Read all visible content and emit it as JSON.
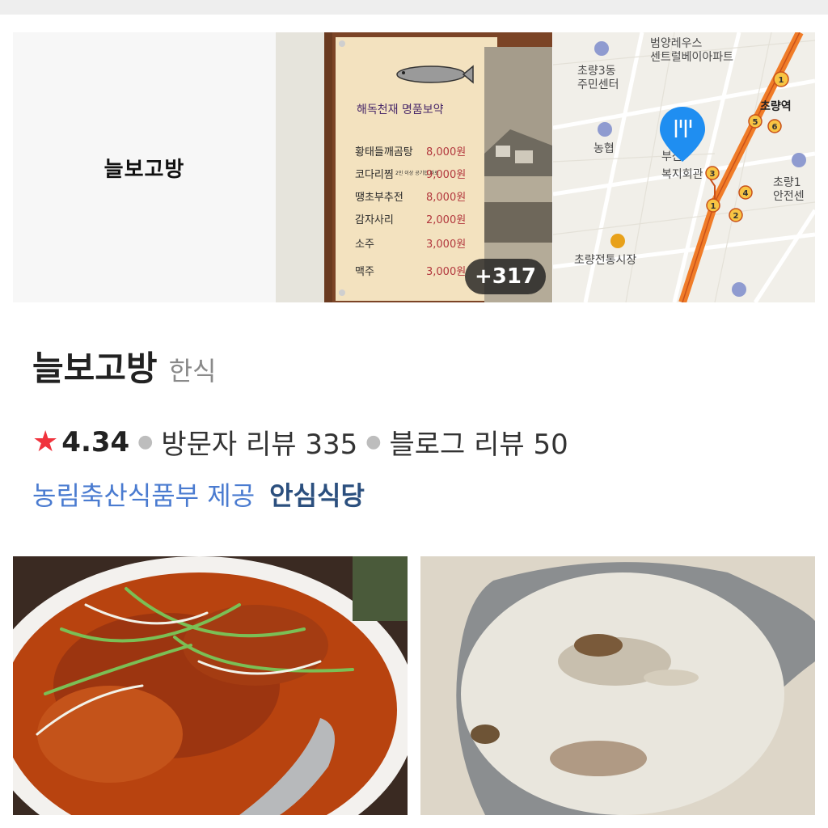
{
  "header": {
    "name_tile": "늘보고방",
    "more_photos": "+317"
  },
  "menu_board": {
    "heading": "해독천재 명품보약",
    "items": [
      {
        "name": "황태들깨곰탕",
        "price": "8,000원"
      },
      {
        "name": "코다리찜",
        "note": "2인 이상 공기밥 따로",
        "price": "9,000원"
      },
      {
        "name": "땡초부추전",
        "price": "8,000원"
      },
      {
        "name": "감자사리",
        "price": "2,000원"
      },
      {
        "name": "소주",
        "price": "3,000원"
      },
      {
        "name": "맥주",
        "price": "3,000원"
      }
    ]
  },
  "map": {
    "labels": {
      "apt": "범양레우스\n센트럴베이아파트",
      "center": "초량3동\n주민센터",
      "station": "초량역",
      "bank": "농협",
      "welfare_a": "부산",
      "welfare_b": "복지회관",
      "safety": "초량1\n안전센",
      "market": "초량전통시장"
    },
    "exits": [
      "1",
      "3",
      "4",
      "5",
      "6",
      "1",
      "2"
    ],
    "pin_color": "#1f8ef1",
    "rail_color": "#f07c28"
  },
  "place": {
    "title": "늘보고방",
    "category": "한식",
    "rating": "4.34",
    "visitor_reviews": "방문자 리뷰 335",
    "blog_reviews": "블로그 리뷰 50",
    "cert_source": "농림축산식품부 제공",
    "cert_badge": "안심식당",
    "star_color": "#f0333d",
    "link_color": "#4a7bd0"
  }
}
